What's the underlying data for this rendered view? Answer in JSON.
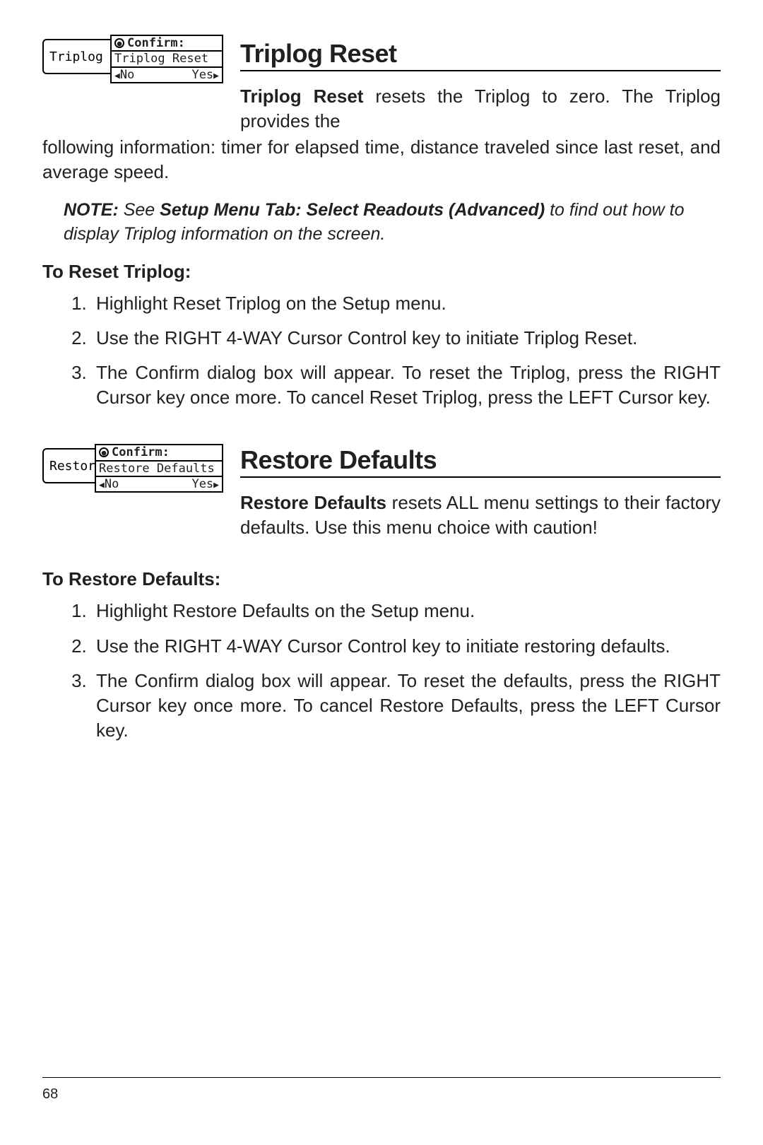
{
  "page_number": "68",
  "section1": {
    "heading": "Triplog Reset",
    "thumbnail": {
      "menu_item": "Triplog Rese",
      "confirm_label": "Confirm:",
      "confirm_body": "Triplog Reset",
      "no_label": "No",
      "yes_label": "Yes"
    },
    "lead_bold": "Triplog Reset",
    "lead_rest": " resets the Triplog to zero. The Triplog provides the",
    "para_continuation": "following information: timer for elapsed time, distance traveled since last reset, and average speed.",
    "note_prefix": "NOTE:",
    "note_mid": " See ",
    "note_bold": "Setup Menu Tab: Select Readouts (Advanced)",
    "note_rest": " to find out how to display Triplog information on the screen.",
    "subhead": "To Reset Triplog:",
    "steps": [
      "Highlight Reset Triplog on the Setup menu.",
      "Use the RIGHT 4-WAY Cursor Control key to initiate Triplog Reset.",
      "The Confirm dialog box will appear. To reset the Triplog, press the RIGHT Cursor key once more. To cancel Reset Triplog, press the LEFT Cursor key."
    ]
  },
  "section2": {
    "heading": "Restore Defaults",
    "thumbnail": {
      "menu_item": "Restore De",
      "confirm_label": "Confirm:",
      "confirm_body": "Restore Defaults",
      "no_label": "No",
      "yes_label": "Yes"
    },
    "lead_bold": "Restore Defaults",
    "lead_rest": " resets ALL menu settings to their factory defaults. Use this menu choice with caution!",
    "subhead": "To Restore Defaults:",
    "steps": [
      "Highlight Restore Defaults on the Setup menu.",
      "Use the RIGHT 4-WAY Cursor Control key to initiate restoring defaults.",
      "The Confirm dialog box will appear. To reset the defaults,  press the RIGHT Cursor key once more. To cancel Restore Defaults, press the LEFT Cursor key."
    ]
  }
}
